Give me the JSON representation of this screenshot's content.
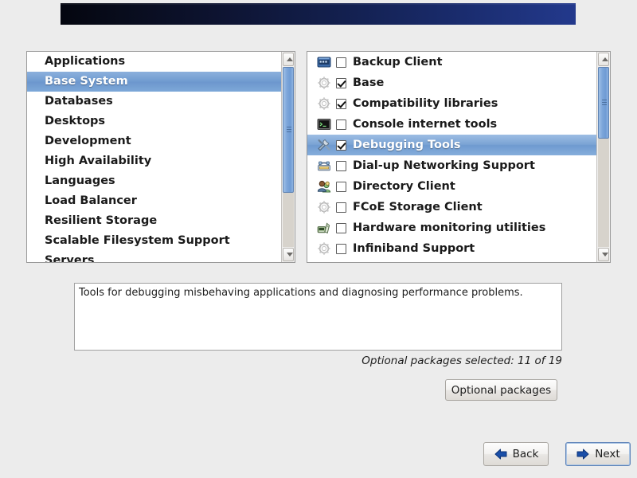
{
  "banner": {
    "name": "installer-banner"
  },
  "group_list": {
    "name": "package-group-list",
    "items": [
      {
        "label": "Applications",
        "selected": false
      },
      {
        "label": "Base System",
        "selected": true
      },
      {
        "label": "Databases",
        "selected": false
      },
      {
        "label": "Desktops",
        "selected": false
      },
      {
        "label": "Development",
        "selected": false
      },
      {
        "label": "High Availability",
        "selected": false
      },
      {
        "label": "Languages",
        "selected": false
      },
      {
        "label": "Load Balancer",
        "selected": false
      },
      {
        "label": "Resilient Storage",
        "selected": false
      },
      {
        "label": "Scalable Filesystem Support",
        "selected": false
      },
      {
        "label": "Servers",
        "selected": false
      }
    ],
    "scrollbar": {
      "thumb_top_pct": 0,
      "thumb_height_pct": 70
    }
  },
  "package_list": {
    "name": "package-checkbox-list",
    "items": [
      {
        "label": "Backup Client",
        "checked": false,
        "selected": false,
        "icon": "terminal-blue-icon"
      },
      {
        "label": "Base",
        "checked": true,
        "selected": false,
        "icon": "gear-icon"
      },
      {
        "label": "Compatibility libraries",
        "checked": true,
        "selected": false,
        "icon": "gear-icon"
      },
      {
        "label": "Console internet tools",
        "checked": false,
        "selected": false,
        "icon": "console-icon"
      },
      {
        "label": "Debugging Tools",
        "checked": true,
        "selected": true,
        "icon": "tools-icon"
      },
      {
        "label": "Dial-up Networking Support",
        "checked": false,
        "selected": false,
        "icon": "telephone-icon"
      },
      {
        "label": "Directory Client",
        "checked": false,
        "selected": false,
        "icon": "users-icon"
      },
      {
        "label": "FCoE Storage Client",
        "checked": false,
        "selected": false,
        "icon": "gear-icon"
      },
      {
        "label": "Hardware monitoring utilities",
        "checked": false,
        "selected": false,
        "icon": "hardware-monitor-icon"
      },
      {
        "label": "Infiniband Support",
        "checked": false,
        "selected": false,
        "icon": "gear-icon"
      }
    ],
    "scrollbar": {
      "thumb_top_pct": 0,
      "thumb_height_pct": 40
    }
  },
  "description": {
    "name": "package-description",
    "text": "Tools for debugging misbehaving applications and diagnosing performance problems."
  },
  "status": {
    "optional_packages_selected": "Optional packages selected: 11 of 19"
  },
  "buttons": {
    "optional_packages": "Optional packages",
    "back": "Back",
    "next": "Next"
  },
  "colors": {
    "selection_blue": "#7aa3d4",
    "banner_dark": "#04060f",
    "banner_light": "#23398c",
    "arrow_blue": "#1b4fa8",
    "window_bg": "#ececec"
  }
}
